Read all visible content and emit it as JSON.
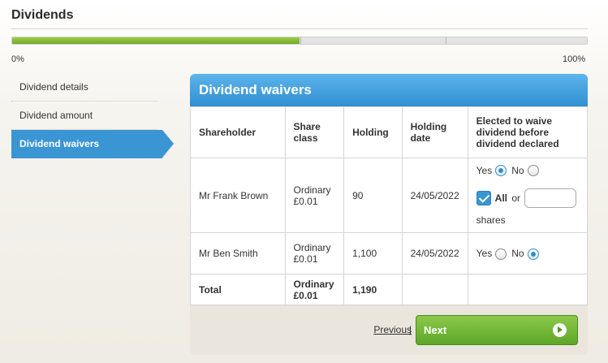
{
  "page": {
    "title": "Dividends"
  },
  "progress": {
    "min_label": "0%",
    "max_label": "100%",
    "value_fraction": 0.5
  },
  "steps": [
    {
      "label": "Dividend details",
      "active": false
    },
    {
      "label": "Dividend amount",
      "active": false
    },
    {
      "label": "Dividend waivers",
      "active": true
    }
  ],
  "panel": {
    "title": "Dividend waivers",
    "columns": [
      "Shareholder",
      "Share class",
      "Holding",
      "Holding date",
      "Elected to waive dividend before dividend declared"
    ],
    "rows": [
      {
        "shareholder": "Mr Frank Brown",
        "share_class": "Ordinary £0.01",
        "holding": "90",
        "holding_date": "24/05/2022",
        "waive": "Yes",
        "all_checked": true,
        "shares_value": ""
      },
      {
        "shareholder": "Mr Ben Smith",
        "share_class": "Ordinary £0.01",
        "holding": "1,100",
        "holding_date": "24/05/2022",
        "waive": "No"
      }
    ],
    "total": {
      "label": "Total",
      "share_class": "Ordinary £0.01",
      "holding": "1,190"
    },
    "labels": {
      "yes": "Yes",
      "no": "No",
      "all": "All",
      "or": "or",
      "shares": "shares"
    }
  },
  "footer": {
    "previous_label": "Previous",
    "separator": "|",
    "next_label": "Next"
  },
  "colors": {
    "accent_blue": "#3a95d3",
    "progress_green": "#8dc63f",
    "next_green": "#6fb535"
  }
}
